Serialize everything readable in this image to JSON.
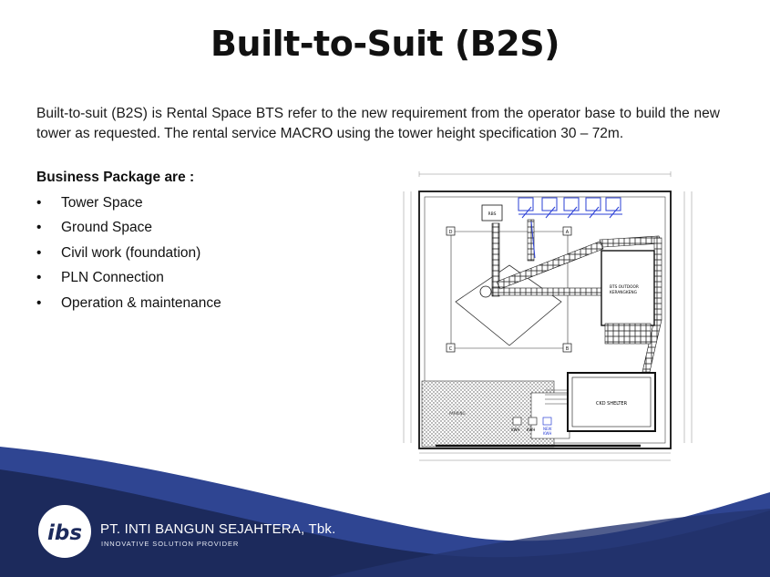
{
  "slide": {
    "title": "Built-to-Suit (B2S)",
    "intro": "Built-to-suit (B2S) is Rental Space BTS refer to the new requirement from the operator base to build the new tower as requested. The rental service MACRO using the tower height specification 30 – 72m.",
    "package_heading": "Business Package are :",
    "bullet": "•",
    "packages": [
      "Tower Space",
      "Ground Space",
      "Civil work (foundation)",
      "PLN Connection",
      "Operation & maintenance"
    ]
  },
  "drawing": {
    "labels": {
      "rbs": "RBS",
      "bts_outdoor": "BTS OUTDOOR",
      "bts_outdoor_2": "KERANGKENG",
      "shelter": "CKD SHELTER",
      "parking": "PARKING",
      "kwh1": "KWH",
      "kwh2": "KWH",
      "new_kwh": "NEW",
      "new_kwh_2": "KWH",
      "grid_d": "D",
      "grid_a": "A",
      "grid_c": "C",
      "grid_b": "B"
    }
  },
  "footer": {
    "company": "PT. INTI BANGUN SEJAHTERA, Tbk.",
    "tagline": "INNOVATIVE SOLUTION PROVIDER",
    "logo_text": "ibs"
  },
  "colors": {
    "navy": "#1c2a5c",
    "mid_blue": "#2f4592",
    "white": "#ffffff",
    "drawing_blue": "#2a3fd6"
  }
}
